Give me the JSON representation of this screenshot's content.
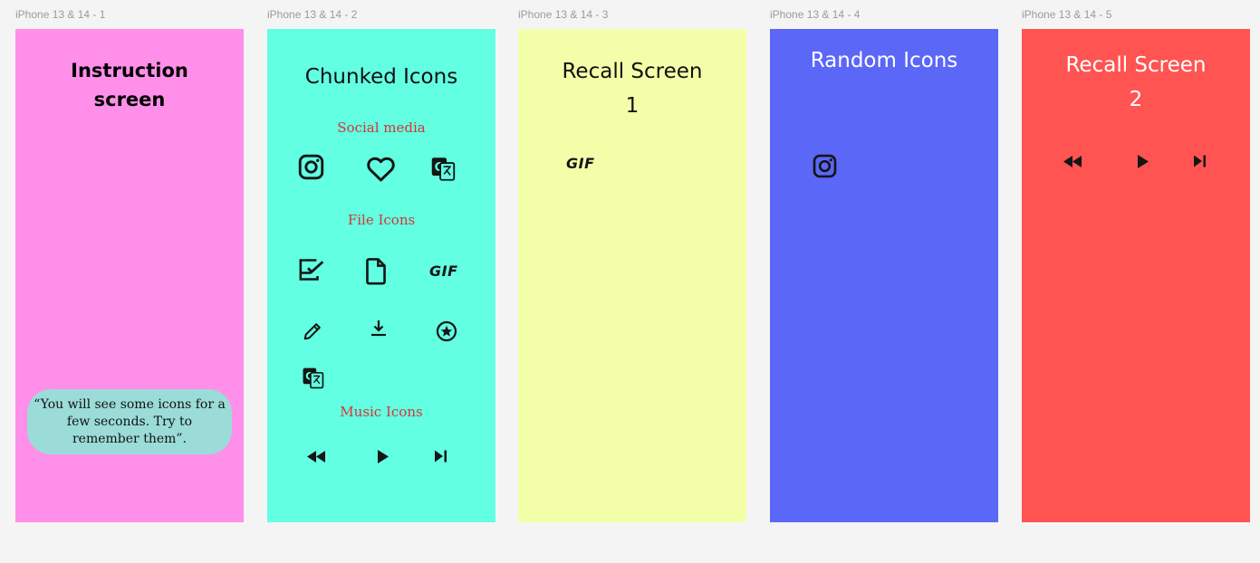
{
  "frames": [
    {
      "label": "iPhone 13 & 14 - 1",
      "color": "#ff8fe9",
      "title_line1": "Instruction",
      "title_line2": "screen",
      "bubble_text": "“You will see some icons for a few seconds. Try to remember them”.",
      "bubble_color": "#9bdcd8"
    },
    {
      "label": "iPhone 13 & 14 - 2",
      "color": "#62ffe2",
      "title": "Chunked Icons",
      "sections": {
        "social": "Social media",
        "file": "File Icons",
        "music": "Music Icons"
      },
      "icons": {
        "social": [
          "instagram-icon",
          "heart-icon",
          "translate-icon"
        ],
        "file": [
          "edit-note-icon",
          "file-icon",
          "gif-icon",
          "pencil-icon",
          "download-icon",
          "star-circle-icon",
          "translate-icon"
        ],
        "music": [
          "rewind-icon",
          "play-icon",
          "skip-next-icon"
        ]
      },
      "gif_text": "GIF"
    },
    {
      "label": "iPhone 13 & 14 - 3",
      "color": "#f2ffa8",
      "title_line1": "Recall Screen",
      "title_line2": "1",
      "gif_text": "GIF"
    },
    {
      "label": "iPhone 13 & 14 - 4",
      "color": "#5b67f7",
      "title": "Random Icons",
      "icons": [
        "instagram-icon"
      ]
    },
    {
      "label": "iPhone 13 & 14 - 5",
      "color": "#ff5452",
      "title_line1": "Recall Screen",
      "title_line2": "2",
      "icons": [
        "rewind-icon",
        "play-icon",
        "skip-next-icon"
      ]
    }
  ]
}
